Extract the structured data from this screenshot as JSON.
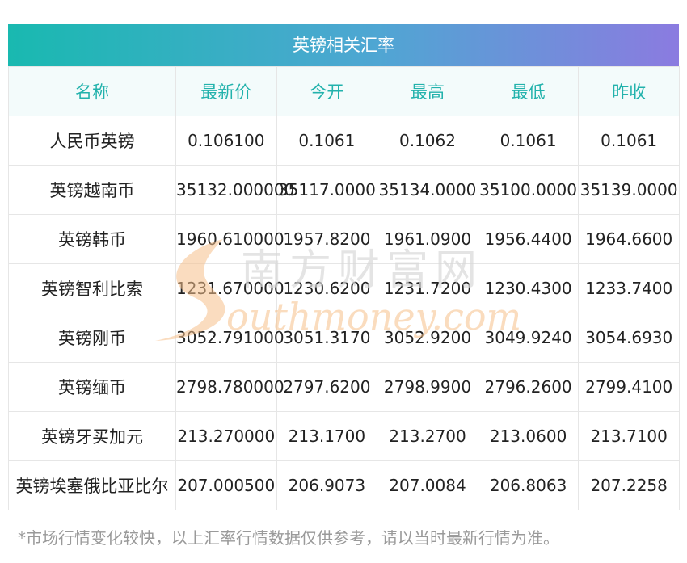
{
  "title": "英镑相关汇率",
  "columns": [
    "名称",
    "最新价",
    "今开",
    "最高",
    "最低",
    "昨收"
  ],
  "rows": [
    {
      "name": "人民币英镑",
      "latest": "0.106100",
      "open": "0.1061",
      "high": "0.1062",
      "low": "0.1061",
      "prev_close": "0.1061"
    },
    {
      "name": "英镑越南币",
      "latest": "35132.000000",
      "open": "35117.0000",
      "high": "35134.0000",
      "low": "35100.0000",
      "prev_close": "35139.0000"
    },
    {
      "name": "英镑韩币",
      "latest": "1960.610000",
      "open": "1957.8200",
      "high": "1961.0900",
      "low": "1956.4400",
      "prev_close": "1964.6600"
    },
    {
      "name": "英镑智利比索",
      "latest": "1231.670000",
      "open": "1230.6200",
      "high": "1231.7200",
      "low": "1230.4300",
      "prev_close": "1233.7400"
    },
    {
      "name": "英镑刚币",
      "latest": "3052.791000",
      "open": "3051.3170",
      "high": "3052.9200",
      "low": "3049.9240",
      "prev_close": "3054.6930"
    },
    {
      "name": "英镑缅币",
      "latest": "2798.780000",
      "open": "2797.6200",
      "high": "2798.9900",
      "low": "2796.2600",
      "prev_close": "2799.4100"
    },
    {
      "name": "英镑牙买加元",
      "latest": "213.270000",
      "open": "213.1700",
      "high": "213.2700",
      "low": "213.0600",
      "prev_close": "213.7100"
    },
    {
      "name": "英镑埃塞俄比亚比尔",
      "latest": "207.000500",
      "open": "206.9073",
      "high": "207.0084",
      "low": "206.8063",
      "prev_close": "207.2258"
    }
  ],
  "watermark": {
    "cn": "南方财富网",
    "en": "outhmoney.com"
  },
  "footnote": "*市场行情变化较快，以上汇率行情数据仅供参考，请以当时最新行情为准。",
  "colors": {
    "header_text": "#22b2ac",
    "header_bg": "#f3fbfb",
    "title_gradient_start": "#19b9b0",
    "title_gradient_end": "#8b7be0"
  }
}
